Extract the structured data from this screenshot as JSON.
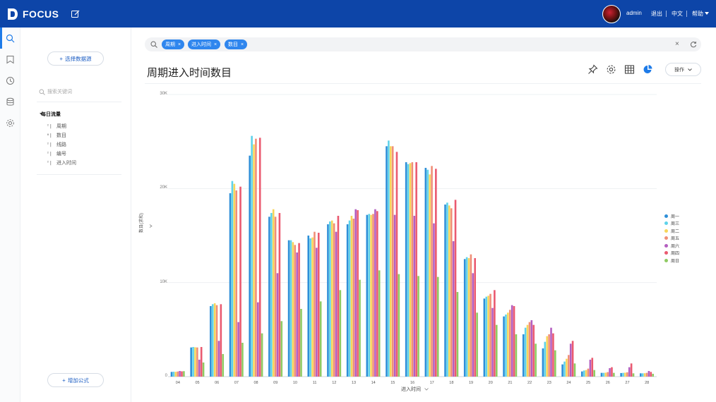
{
  "app": {
    "brand": "FOCUS",
    "user": "admin",
    "links": [
      "退出",
      "中文",
      "帮助"
    ]
  },
  "left_panel": {
    "select_source_label": "选择数据源",
    "keyword_placeholder": "搜索关键词",
    "tree_title": "每日流量",
    "tree_items": [
      {
        "label": "周期",
        "type": "text-icon"
      },
      {
        "label": "数目",
        "type": "number-icon"
      },
      {
        "label": "线路",
        "type": "text-icon"
      },
      {
        "label": "编号",
        "type": "text-icon"
      },
      {
        "label": "进入时间",
        "type": "text-icon"
      }
    ],
    "add_formula_label": "增加公式"
  },
  "search": {
    "tags": [
      "周期",
      "进入时间",
      "数目"
    ]
  },
  "main": {
    "title": "周期进入时间数目",
    "operate_label": "操作"
  },
  "colors": {
    "header": "#0d45a8",
    "accent": "#2f86ee"
  },
  "chart_data": {
    "type": "bar",
    "categories": [
      "04",
      "05",
      "06",
      "07",
      "08",
      "09",
      "10",
      "11",
      "12",
      "13",
      "14",
      "15",
      "16",
      "17",
      "18",
      "19",
      "20",
      "21",
      "22",
      "23",
      "24",
      "25",
      "26",
      "27",
      "28"
    ],
    "xlabel": "进入时间",
    "ylabel": "数目(求和)",
    "ylim": [
      0,
      30000
    ],
    "yticks": [
      "0",
      "10K",
      "20K",
      "30K"
    ],
    "legend_position": "right",
    "series": [
      {
        "name": "周一",
        "color": "#2e8fd8",
        "values": [
          500,
          3100,
          7500,
          19500,
          23500,
          17000,
          14500,
          15000,
          16200,
          16200,
          17200,
          24500,
          22800,
          22200,
          18300,
          12500,
          8300,
          6400,
          4500,
          3000,
          1300,
          550,
          400,
          380,
          350
        ]
      },
      {
        "name": "周三",
        "color": "#5fd3ea",
        "values": [
          520,
          3150,
          7700,
          20800,
          25600,
          17400,
          14500,
          14700,
          16500,
          16600,
          17300,
          25100,
          22600,
          22000,
          18500,
          12700,
          8500,
          6600,
          5200,
          3700,
          1600,
          650,
          400,
          400,
          350
        ]
      },
      {
        "name": "周二",
        "color": "#f7d65a",
        "values": [
          510,
          3120,
          7800,
          20500,
          24700,
          17800,
          14300,
          14800,
          16600,
          17100,
          17200,
          24500,
          22700,
          21500,
          18200,
          12600,
          8600,
          6800,
          5500,
          4300,
          1900,
          700,
          420,
          420,
          360
        ]
      },
      {
        "name": "周五",
        "color": "#f08f78",
        "values": [
          540,
          3100,
          7600,
          19800,
          25300,
          17000,
          14000,
          15400,
          16300,
          16800,
          17300,
          24500,
          22800,
          22400,
          17900,
          13000,
          8800,
          7100,
          5800,
          4500,
          2300,
          850,
          480,
          460,
          400
        ]
      },
      {
        "name": "周六",
        "color": "#b45fc0",
        "values": [
          600,
          1800,
          3800,
          5800,
          7900,
          11000,
          13200,
          13700,
          15400,
          17800,
          17800,
          17200,
          17100,
          16300,
          14400,
          11000,
          7300,
          7600,
          6000,
          5200,
          3500,
          1800,
          900,
          1000,
          600
        ]
      },
      {
        "name": "周四",
        "color": "#ea5a70",
        "values": [
          560,
          3150,
          7700,
          20200,
          25400,
          17400,
          14200,
          15300,
          17100,
          17700,
          17600,
          23900,
          22800,
          22100,
          18800,
          12600,
          9200,
          7500,
          5500,
          4600,
          3800,
          2000,
          1000,
          1400,
          500
        ]
      },
      {
        "name": "周日",
        "color": "#8fca62",
        "values": [
          580,
          1500,
          2400,
          3600,
          4600,
          5900,
          7200,
          8000,
          9200,
          10300,
          11300,
          10900,
          10700,
          10600,
          9000,
          6800,
          5500,
          4500,
          3500,
          2800,
          1400,
          700,
          400,
          350,
          300
        ]
      }
    ]
  }
}
